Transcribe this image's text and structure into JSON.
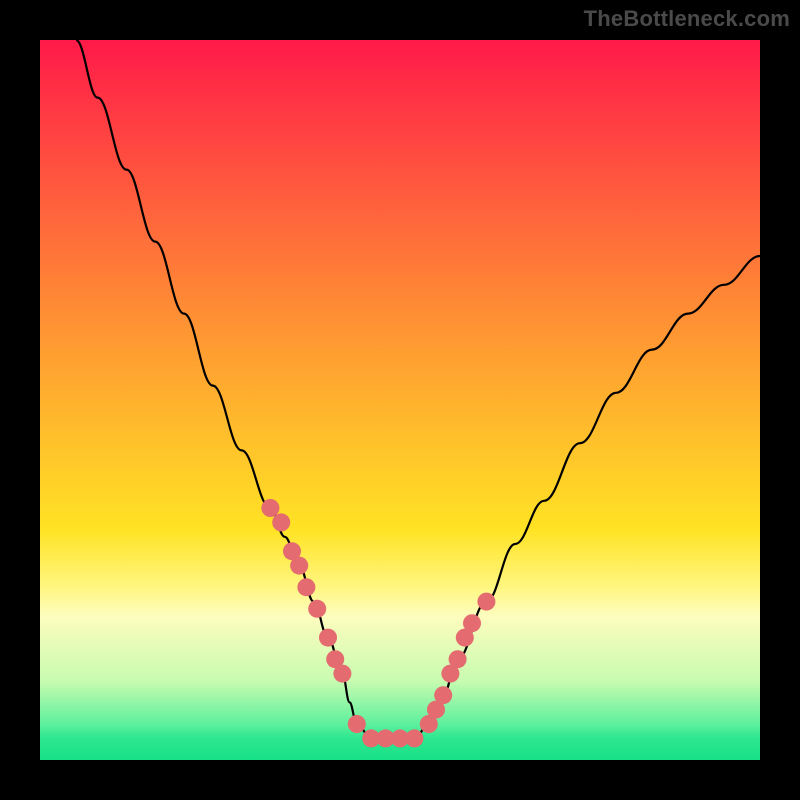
{
  "watermark": "TheBottleneck.com",
  "chart_data": {
    "type": "line",
    "title": "",
    "xlabel": "",
    "ylabel": "",
    "xlim": [
      0,
      100
    ],
    "ylim": [
      0,
      100
    ],
    "series": [
      {
        "name": "bottleneck-curve",
        "x": [
          5,
          8,
          12,
          16,
          20,
          24,
          28,
          32,
          34,
          36,
          38,
          40,
          42,
          43,
          44,
          46,
          48,
          50,
          52,
          54,
          56,
          58,
          62,
          66,
          70,
          75,
          80,
          85,
          90,
          95,
          100
        ],
        "y": [
          100,
          92,
          82,
          72,
          62,
          52,
          43,
          35,
          31,
          27,
          22,
          17,
          12,
          8,
          5,
          3,
          3,
          3,
          3,
          5,
          9,
          14,
          22,
          30,
          36,
          44,
          51,
          57,
          62,
          66,
          70
        ]
      }
    ],
    "markers": {
      "name": "highlight-points",
      "x": [
        32,
        33.5,
        35,
        36,
        37,
        38.5,
        40,
        41,
        42,
        44,
        46,
        48,
        50,
        52,
        54,
        55,
        56,
        57,
        58,
        59,
        60,
        62
      ],
      "y": [
        35,
        33,
        29,
        27,
        24,
        21,
        17,
        14,
        12,
        5,
        3,
        3,
        3,
        3,
        5,
        7,
        9,
        12,
        14,
        17,
        19,
        22
      ]
    },
    "gradient_stops": [
      {
        "pos": 0,
        "color": "#ff1a49"
      },
      {
        "pos": 12,
        "color": "#ff3f42"
      },
      {
        "pos": 26,
        "color": "#ff6a3b"
      },
      {
        "pos": 40,
        "color": "#ff9433"
      },
      {
        "pos": 55,
        "color": "#ffbf2b"
      },
      {
        "pos": 68,
        "color": "#ffe324"
      },
      {
        "pos": 76,
        "color": "#fff680"
      },
      {
        "pos": 80,
        "color": "#fdfdbe"
      },
      {
        "pos": 89,
        "color": "#c8fbb0"
      },
      {
        "pos": 95,
        "color": "#5ef09d"
      },
      {
        "pos": 97,
        "color": "#2de68f"
      },
      {
        "pos": 100,
        "color": "#17e187"
      }
    ],
    "notes": "V-shaped curve over a vertical red→yellow→green gradient; markers cluster around the valley. No visible axis ticks or labels."
  }
}
